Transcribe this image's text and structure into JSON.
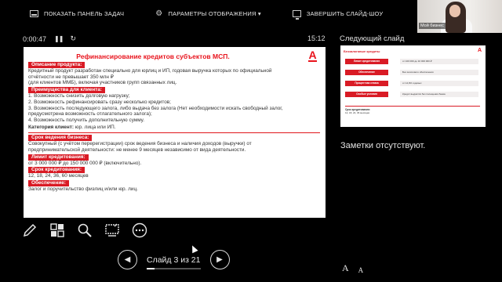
{
  "toolbar": {
    "taskbar_label": "ПОКАЗАТЬ ПАНЕЛЬ ЗАДАЧ",
    "display_label": "ПАРАМЕТРЫ ОТОБРАЖЕНИЯ ▾",
    "end_label": "ЗАВЕРШИТЬ СЛАЙД-ШОУ"
  },
  "webcam": {
    "label": "Мой бизнес"
  },
  "timer": {
    "elapsed": "0:00:47",
    "pause": "❚❚",
    "reset": "↻",
    "clock": "15:12"
  },
  "slide": {
    "title": "Рефинансирование кредитов субъектов МСП.",
    "logo": "А",
    "sections": [
      {
        "header": "Описание продукта:",
        "lines": [
          "Кредитный продукт разработан специально для юрлиц и ИП, годовая выручка которых по официальной",
          "отчётности не превышает 350 млн ₽",
          "(для клиентов ММБ), включая участников групп связанных лиц."
        ]
      },
      {
        "header": "Преимущества для клиента:",
        "lines": [
          "1. Возможность снизить долговую нагрузку;",
          "2. Возможность рефинансировать сразу несколько кредитов;",
          "3. Возможность последующего залога, либо выдача без залога (Нет необходимости искать свободный залог,",
          "предусмотрена возможность отлагательного залога);",
          "4. Возможность получить дополнительную сумму."
        ]
      },
      {
        "bold_prefix": "Категория клиент:",
        "tail": " юр. лица или ИП."
      },
      {
        "header": "Срок ведения бизнеса:",
        "lines": [
          "Совокупный (с учётом перерегистрации) срок ведения бизнеса и наличия доходов (выручки) от",
          "предпринимательской деятельности: не менее 9 месяцев независимо от вида деятельности."
        ]
      },
      {
        "header": "Лимит кредитования:",
        "lines": [
          "от 3 000 000 ₽ до 150 000 000 ₽ (включительно)."
        ]
      },
      {
        "header": "Срок кредитования:",
        "lines": [
          "12, 18, 24, 36, 60 месяцев"
        ]
      },
      {
        "header": "Обеспечение:",
        "lines": [
          "Залог и поручительство физлиц и/или юр. лиц."
        ]
      }
    ]
  },
  "next_slide": {
    "label": "Следующий слайд",
    "title": "Беззалоговые кредиты",
    "logo": "А",
    "rows": [
      {
        "name": "Лимит кредитования",
        "value": "от 100 000 до 10 000 000 ₽"
      },
      {
        "name": "Обеспечение",
        "value": "Без залогового обеспечения"
      },
      {
        "name": "Процентная ставка",
        "value": "от 14,9% годовых"
      },
      {
        "name": "Особые условия",
        "value": "Кредит выдаётся без посещения банка"
      }
    ],
    "footer_title": "Срок кредитования:",
    "footer_text": "12, 18, 24, 36 месяцев"
  },
  "notes": {
    "text": "Заметки отсутствуют."
  },
  "tools": [
    "pen-icon",
    "slides-grid-icon",
    "zoom-icon",
    "pointer-screen-icon",
    "more-icon"
  ],
  "nav": {
    "prev": "◀",
    "next": "▶",
    "label": "Слайд 3 из 21",
    "progress": 0.143
  },
  "font_ctrl": {
    "increase": "A",
    "decrease": "A"
  }
}
